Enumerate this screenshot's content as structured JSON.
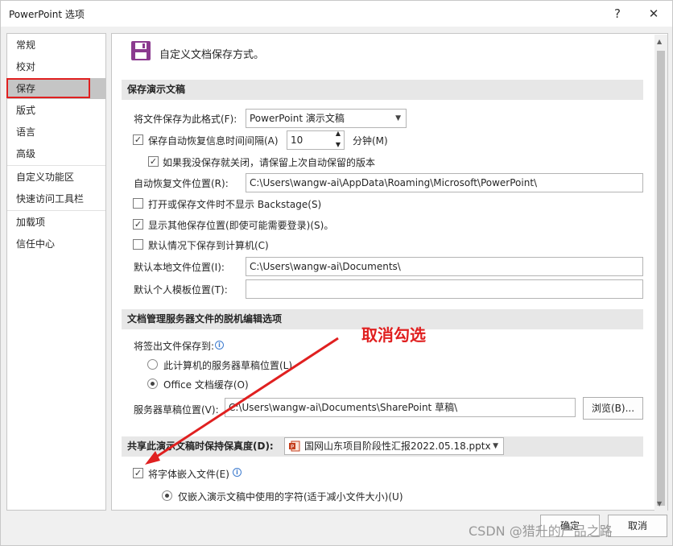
{
  "window": {
    "title": "PowerPoint 选项",
    "help_glyph": "?",
    "close_glyph": "✕"
  },
  "nav": {
    "items": [
      {
        "label": "常规"
      },
      {
        "label": "校对"
      },
      {
        "label": "保存",
        "selected": true
      },
      {
        "label": "版式"
      },
      {
        "label": "语言"
      },
      {
        "label": "高级"
      },
      {
        "label": "自定义功能区"
      },
      {
        "label": "快速访问工具栏"
      },
      {
        "label": "加载项"
      },
      {
        "label": "信任中心"
      }
    ]
  },
  "page": {
    "heading": "自定义文档保存方式。",
    "icon": "save-disk-icon"
  },
  "save_section": {
    "header": "保存演示文稿",
    "format_label": "将文件保存为此格式(F):",
    "format_value": "PowerPoint 演示文稿",
    "autorecover_label": "保存自动恢复信息时间间隔(A)",
    "autorecover_checked": true,
    "autorecover_minutes": "10",
    "minutes_label": "分钟(M)",
    "keep_last_label": "如果我没保存就关闭，请保留上次自动保留的版本",
    "keep_last_checked": true,
    "autorecover_location_label": "自动恢复文件位置(R):",
    "autorecover_location_value": "C:\\Users\\wangw-ai\\AppData\\Roaming\\Microsoft\\PowerPoint\\",
    "no_backstage_label": "打开或保存文件时不显示 Backstage(S)",
    "no_backstage_checked": false,
    "show_more_label": "显示其他保存位置(即使可能需要登录)(S)。",
    "show_more_checked": true,
    "default_computer_label": "默认情况下保存到计算机(C)",
    "default_computer_checked": false,
    "default_local_label": "默认本地文件位置(I):",
    "default_local_value": "C:\\Users\\wangw-ai\\Documents\\",
    "default_template_label": "默认个人模板位置(T):",
    "default_template_value": ""
  },
  "offline_section": {
    "header": "文档管理服务器文件的脱机编辑选项",
    "checkout_label": "将签出文件保存到:",
    "server_drafts_option": "此计算机的服务器草稿位置(L)",
    "office_cache_option": "Office 文档缓存(O)",
    "selected_option": "office_cache",
    "drafts_location_label": "服务器草稿位置(V):",
    "drafts_location_value": "C:\\Users\\wangw-ai\\Documents\\SharePoint 草稿\\",
    "browse_label": "浏览(B)..."
  },
  "fidelity_section": {
    "header": "共享此演示文稿时保持保真度(D):",
    "file_value": "国网山东项目阶段性汇报2022.05.18.pptx",
    "embed_fonts_label": "将字体嵌入文件(E)",
    "embed_fonts_checked": true,
    "embed_used_only_label": "仅嵌入演示文稿中使用的字符(适于减小文件大小)(U)"
  },
  "footer": {
    "ok_label": "确定",
    "cancel_label": "取消"
  },
  "annotation": {
    "text": "取消勾选",
    "color": "#e02020"
  },
  "watermark": {
    "text": "CSDN @猎升的产品之路"
  },
  "colors": {
    "selected_nav": "#c5c5c5",
    "section_header": "#e7e7e7",
    "annotation_red": "#e02020",
    "save_icon_purple": "#8b3a8f"
  }
}
